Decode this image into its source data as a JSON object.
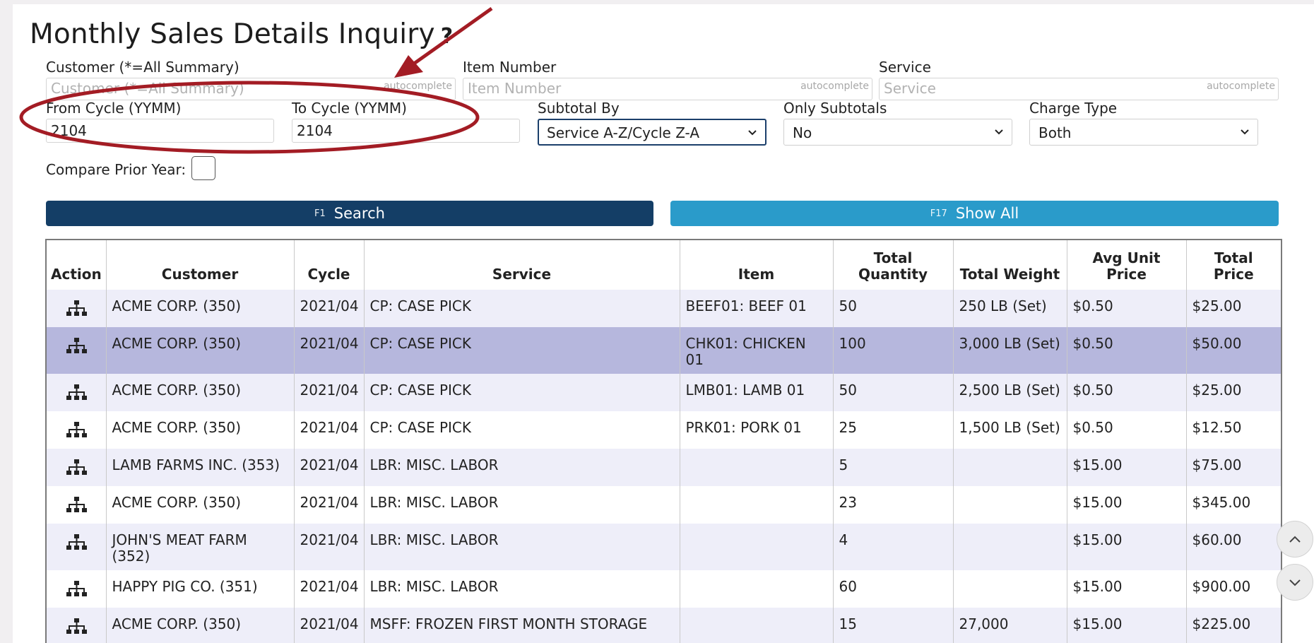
{
  "title": "Monthly Sales Details Inquiry",
  "help_icon_glyph": "?",
  "filters": {
    "customer": {
      "label": "Customer (*=All Summary)",
      "placeholder": "Customer (*=All Summary)",
      "tag": "autocomplete"
    },
    "item_number": {
      "label": "Item Number",
      "placeholder": "Item Number",
      "tag": "autocomplete"
    },
    "service": {
      "label": "Service",
      "placeholder": "Service",
      "tag": "autocomplete"
    },
    "from_cycle": {
      "label": "From Cycle (YYMM)",
      "value": "2104"
    },
    "to_cycle": {
      "label": "To Cycle (YYMM)",
      "value": "2104"
    },
    "subtotal_by": {
      "label": "Subtotal By",
      "value": "Service A-Z/Cycle Z-A"
    },
    "only_subtotals": {
      "label": "Only Subtotals",
      "value": "No"
    },
    "charge_type": {
      "label": "Charge Type",
      "value": "Both"
    },
    "compare_prior_year": {
      "label": "Compare Prior Year:",
      "checked": false
    }
  },
  "buttons": {
    "search": {
      "fkey": "F1",
      "label": "Search"
    },
    "show_all": {
      "fkey": "F17",
      "label": "Show All"
    }
  },
  "table": {
    "headers": [
      "Action",
      "Customer",
      "Cycle",
      "Service",
      "Item",
      "Total Quantity",
      "Total Weight",
      "Avg Unit Price",
      "Total Price"
    ],
    "rows": [
      [
        "ACME CORP. (350)",
        "2021/04",
        "CP: CASE PICK",
        "BEEF01: BEEF 01",
        "50",
        "250 LB (Set)",
        "$0.50",
        "$25.00"
      ],
      [
        "ACME CORP. (350)",
        "2021/04",
        "CP: CASE PICK",
        "CHK01: CHICKEN 01",
        "100",
        "3,000 LB (Set)",
        "$0.50",
        "$50.00"
      ],
      [
        "ACME CORP. (350)",
        "2021/04",
        "CP: CASE PICK",
        "LMB01: LAMB 01",
        "50",
        "2,500 LB (Set)",
        "$0.50",
        "$25.00"
      ],
      [
        "ACME CORP. (350)",
        "2021/04",
        "CP: CASE PICK",
        "PRK01: PORK 01",
        "25",
        "1,500 LB (Set)",
        "$0.50",
        "$12.50"
      ],
      [
        "LAMB FARMS INC. (353)",
        "2021/04",
        "LBR: MISC. LABOR",
        "",
        "5",
        "",
        "$15.00",
        "$75.00"
      ],
      [
        "ACME CORP. (350)",
        "2021/04",
        "LBR: MISC. LABOR",
        "",
        "23",
        "",
        "$15.00",
        "$345.00"
      ],
      [
        "JOHN'S MEAT FARM (352)",
        "2021/04",
        "LBR: MISC. LABOR",
        "",
        "4",
        "",
        "$15.00",
        "$60.00"
      ],
      [
        "HAPPY PIG CO. (351)",
        "2021/04",
        "LBR: MISC. LABOR",
        "",
        "60",
        "",
        "$15.00",
        "$900.00"
      ],
      [
        "ACME CORP. (350)",
        "2021/04",
        "MSFF: FROZEN FIRST MONTH STORAGE",
        "",
        "15",
        "27,000",
        "$15.00",
        "$225.00"
      ]
    ],
    "selected_row": 1,
    "action_icon": "hierarchy-icon"
  },
  "colors": {
    "primary_button": "#143e66",
    "secondary_button": "#2a9bca",
    "selected_row": "#b6b7dd",
    "alt_row": "#eeeef9",
    "annotation": "#a31c24"
  }
}
